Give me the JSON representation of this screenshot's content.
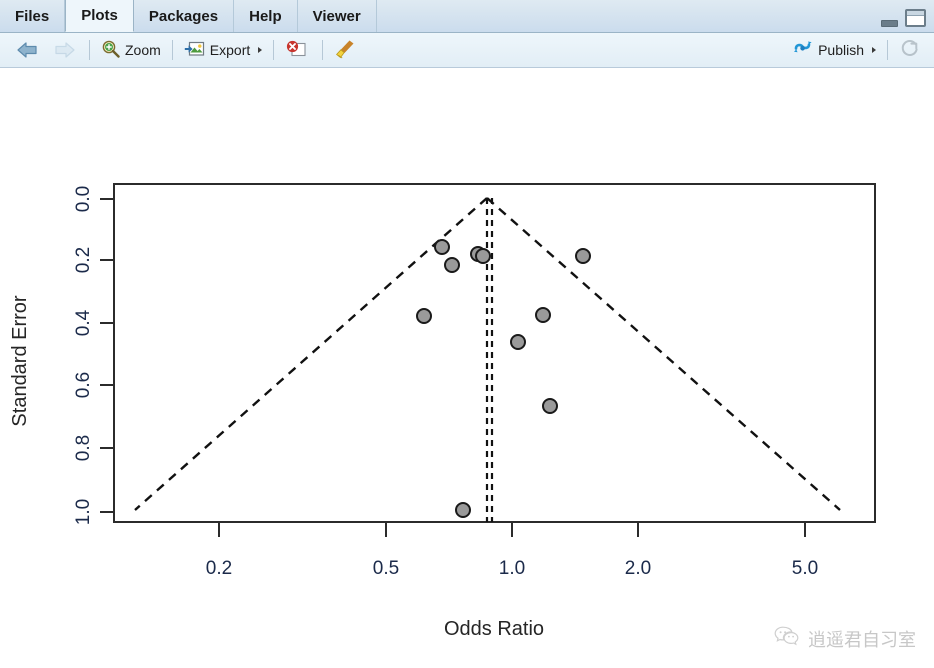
{
  "window": {
    "tabs": [
      {
        "label": "Files",
        "active": false
      },
      {
        "label": "Plots",
        "active": true
      },
      {
        "label": "Packages",
        "active": false
      },
      {
        "label": "Help",
        "active": false
      },
      {
        "label": "Viewer",
        "active": false
      }
    ],
    "minimize_icon": "minimize-icon",
    "maximize_icon": "maximize-icon"
  },
  "toolbar": {
    "back_icon": "back-arrow-icon",
    "forward_icon": "forward-arrow-icon",
    "zoom_label": "Zoom",
    "zoom_icon": "magnifier-plus-icon",
    "export_label": "Export",
    "export_icon": "export-image-icon",
    "export_caret": "chevron-down-icon",
    "remove_icon": "remove-plot-icon",
    "clear_icon": "clear-all-plots-broom-icon",
    "publish_label": "Publish",
    "publish_icon": "publish-icon",
    "publish_caret": "chevron-down-icon",
    "refresh_icon": "refresh-icon"
  },
  "watermark": {
    "icon": "wechat-icon",
    "text": "逍遥君自习室"
  },
  "chart_data": {
    "type": "scatter",
    "title": "",
    "subtitle": "",
    "xlabel": "Odds Ratio",
    "ylabel": "Standard Error",
    "xscale": "log",
    "xticks": [
      0.2,
      0.5,
      1.0,
      2.0,
      5.0
    ],
    "xticklabels": [
      "0.2",
      "0.5",
      "1.0",
      "2.0",
      "5.0"
    ],
    "yticks": [
      0.0,
      0.2,
      0.4,
      0.6,
      0.8,
      1.0
    ],
    "yticklabels": [
      "0.0",
      "0.2",
      "0.4",
      "0.6",
      "0.8",
      "1.0"
    ],
    "ylim": [
      1.04,
      -0.04
    ],
    "xlim": [
      0.155,
      6.2
    ],
    "y_inverted": true,
    "grid": false,
    "legend": false,
    "box": true,
    "series": [
      {
        "name": "studies",
        "marker": "filled-circle",
        "marker_fill": "#999999",
        "marker_edge": "#1a1a1a",
        "points": [
          {
            "or": 0.668,
            "se": 0.158
          },
          {
            "or": 0.705,
            "se": 0.216
          },
          {
            "or": 0.803,
            "se": 0.18
          },
          {
            "or": 0.813,
            "se": 0.187
          },
          {
            "or": 1.521,
            "se": 0.187
          },
          {
            "or": 0.636,
            "se": 0.376
          },
          {
            "or": 1.168,
            "se": 0.373
          },
          {
            "or": 1.034,
            "se": 0.46
          },
          {
            "or": 1.2,
            "se": 0.663
          },
          {
            "or": 0.782,
            "se": 0.998
          }
        ]
      }
    ],
    "reference_lines": [
      {
        "name": "pooled-effect-line",
        "or": 0.864,
        "style": "dashed",
        "orientation": "vertical"
      },
      {
        "name": "null-effect-line",
        "or": 0.884,
        "style": "dashed",
        "orientation": "vertical"
      }
    ],
    "funnel": {
      "name": "pseudo-95-confidence-limits",
      "apex_or": 0.872,
      "style": "dashed",
      "left_end": {
        "or": 0.178,
        "se": 1.0
      },
      "right_end": {
        "or": 4.26,
        "se": 1.0
      }
    }
  }
}
